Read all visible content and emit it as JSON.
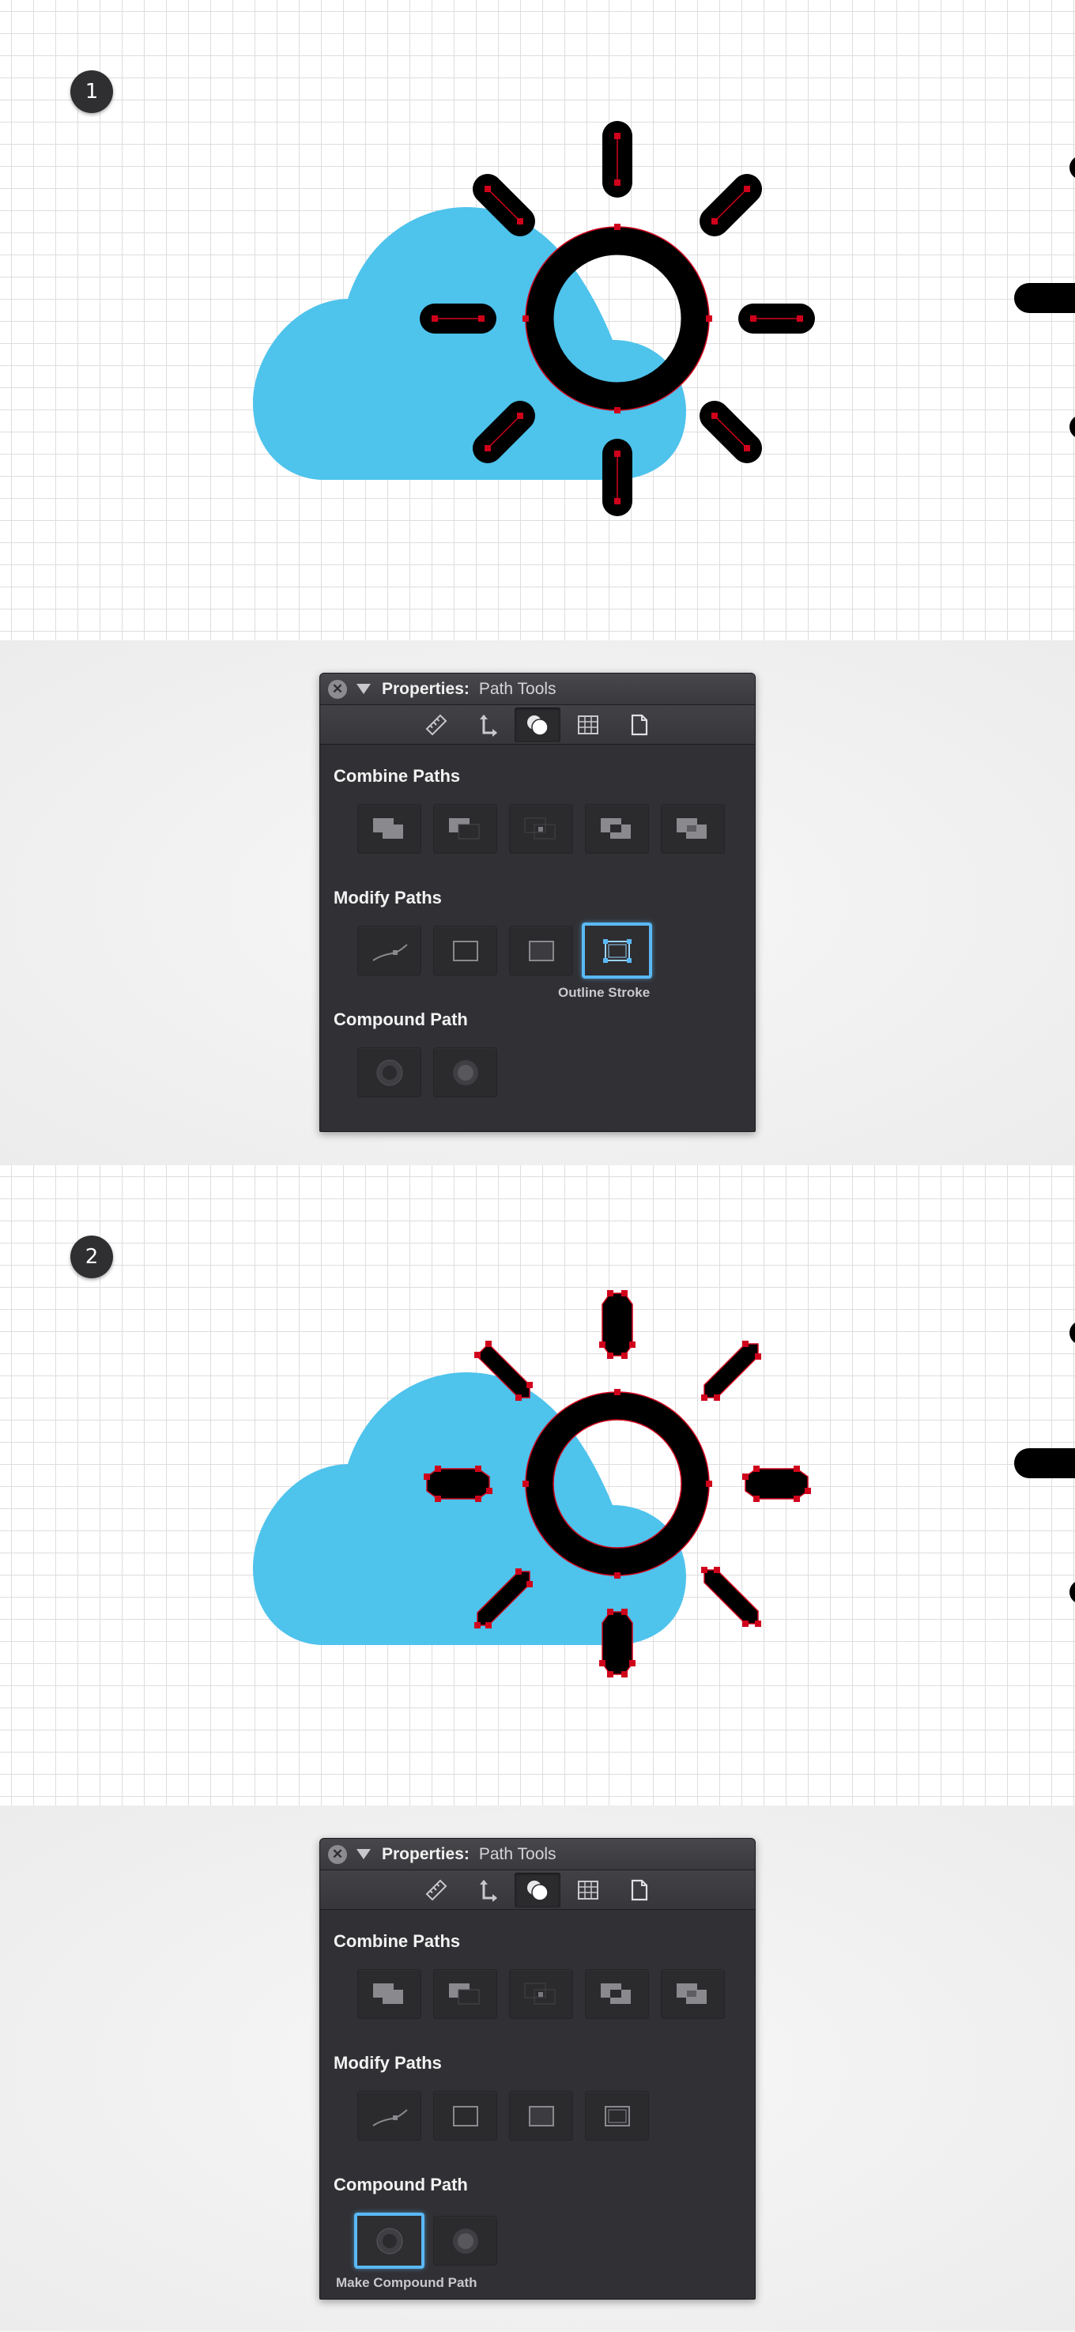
{
  "steps": [
    {
      "number": "1"
    },
    {
      "number": "2"
    }
  ],
  "panel": {
    "title_prefix": "Properties:",
    "title_name": "Path Tools",
    "close_glyph": "✕",
    "tabs": [
      {
        "name": "ruler-icon",
        "active": false
      },
      {
        "name": "transform-arrows-icon",
        "active": false
      },
      {
        "name": "path-tools-icon",
        "active": true
      },
      {
        "name": "grid-icon",
        "active": false
      },
      {
        "name": "document-icon",
        "active": false
      }
    ],
    "sections": {
      "combine": "Combine Paths",
      "modify": "Modify Paths",
      "compound": "Compound Path"
    },
    "combine_buttons": [
      "union-icon",
      "subtract-icon",
      "intersect-icon",
      "exclude-icon",
      "divide-icon"
    ],
    "modify_buttons": [
      "simplify-path-icon",
      "offset-path-icon",
      "expand-fill-icon",
      "outline-stroke-icon"
    ],
    "compound_buttons": [
      "make-compound-path-icon",
      "release-compound-path-icon"
    ]
  },
  "panel1": {
    "selected_label": "Outline Stroke"
  },
  "panel2": {
    "selected_label": "Make Compound Path"
  },
  "colors": {
    "cloud": "#4ec3ec",
    "sun": "#000000",
    "anchor": "#d0021b",
    "selection": "#5ab8f5",
    "panel_bg": "#313135"
  }
}
